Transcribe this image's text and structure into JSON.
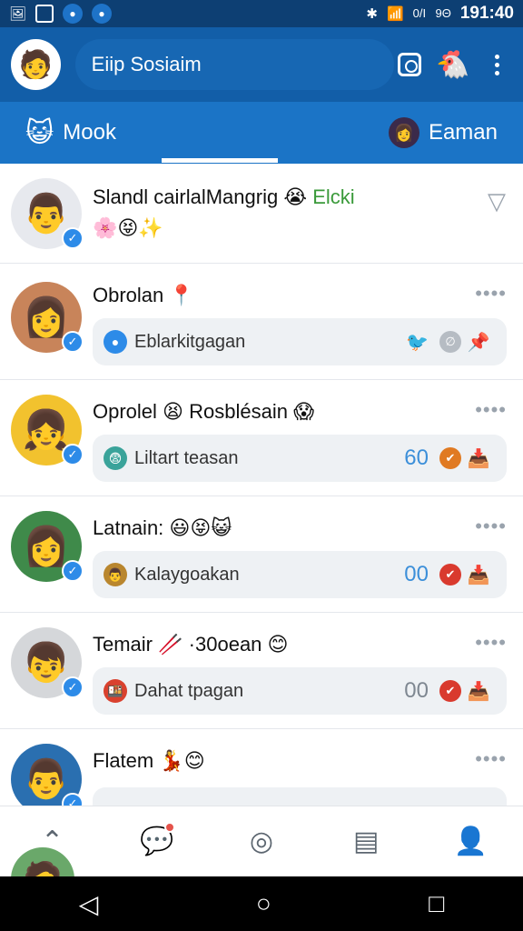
{
  "status_bar": {
    "icons": [
      "photo-icon",
      "gallery-icon",
      "blue-circle-icon",
      "blue-circle-icon"
    ],
    "right_icons": [
      "bluetooth-icon",
      "wifi-icon",
      "signal-icon"
    ],
    "battery_text": "0/I9Θ",
    "time": "191:40"
  },
  "app_bar": {
    "avatar_icon": "user-avatar-icon",
    "title": "Eiip Sosiaim",
    "camera_icon": "camera-icon",
    "mascot_icon": "mascot-icon",
    "menu_icon": "more-vert-icon"
  },
  "tabs": {
    "left": {
      "emoji": "😺",
      "label": "Mook"
    },
    "right": {
      "avatar": "👩",
      "label": "Eaman"
    }
  },
  "feed": {
    "items": [
      {
        "name": "Slandl cairlalMangrig",
        "name_emoji": "😭",
        "tag": "Elcki",
        "tag_color": "#3a9a3a",
        "sub_emoji": "🌸😝✨",
        "avatar_emoji": "👨",
        "avatar_bg": "#e7e9ee",
        "action_icon": "dropdown-triangle-icon"
      },
      {
        "name": "Obrolan",
        "name_emoji": "📍",
        "avatar_emoji": "👩",
        "avatar_bg": "#c8845a",
        "more": "••••",
        "chip": {
          "icon_color": "#2d8be8",
          "icon": "●",
          "text": "Eblarkitgagan",
          "count": "",
          "react1": "🐦",
          "react2": "∅",
          "tail": "📌"
        }
      },
      {
        "name": "Oprolel",
        "name_emoji": "😫",
        "name2": "Rosblésain",
        "name_emoji2": "😱",
        "avatar_emoji": "👧",
        "avatar_bg": "#f2c22e",
        "more": "••••",
        "chip": {
          "icon_color": "#3aa39a",
          "icon": "😨",
          "text": "Liltart teasan",
          "count": "60",
          "react_color": "#e07a22",
          "react": "✔",
          "tail": "📥"
        }
      },
      {
        "name": "Latnain:",
        "name_emoji": "😃😝😺",
        "avatar_emoji": "👩",
        "avatar_bg": "#3f8a4a",
        "more": "••••",
        "chip": {
          "icon_color": "#b9862e",
          "icon": "👨",
          "text": "Kalaygoakan",
          "count": "00",
          "react_color": "#d93a2e",
          "react": "✔",
          "tail": "📥"
        }
      },
      {
        "name": "Temair",
        "name_emoji": "🥢",
        "name2": "·30oean",
        "name_emoji2": "😊",
        "avatar_emoji": "👦",
        "avatar_bg": "#d5d7da",
        "more": "••••",
        "chip": {
          "icon_color": "#d9412e",
          "icon": "🍱",
          "text": "Dahat tpagan",
          "count": "00",
          "count_gray": true,
          "react_color": "#d93a2e",
          "react": "✔",
          "tail": "📥"
        }
      },
      {
        "name": "Flatem",
        "name_emoji": "💃😊",
        "avatar_emoji": "👨",
        "avatar_bg": "#2a6fb0",
        "more": "••••"
      }
    ]
  },
  "bottom_nav": {
    "items": [
      {
        "icon": "⌃",
        "name": "collapse-icon"
      },
      {
        "icon": "💬",
        "name": "chat-icon",
        "active": true,
        "badge": true
      },
      {
        "icon": "◎",
        "name": "camera-circle-icon"
      },
      {
        "icon": "▤",
        "name": "inbox-icon"
      },
      {
        "icon": "👤",
        "name": "profile-icon"
      }
    ]
  },
  "system_nav": {
    "back": "◁",
    "home": "○",
    "recents": "□"
  }
}
